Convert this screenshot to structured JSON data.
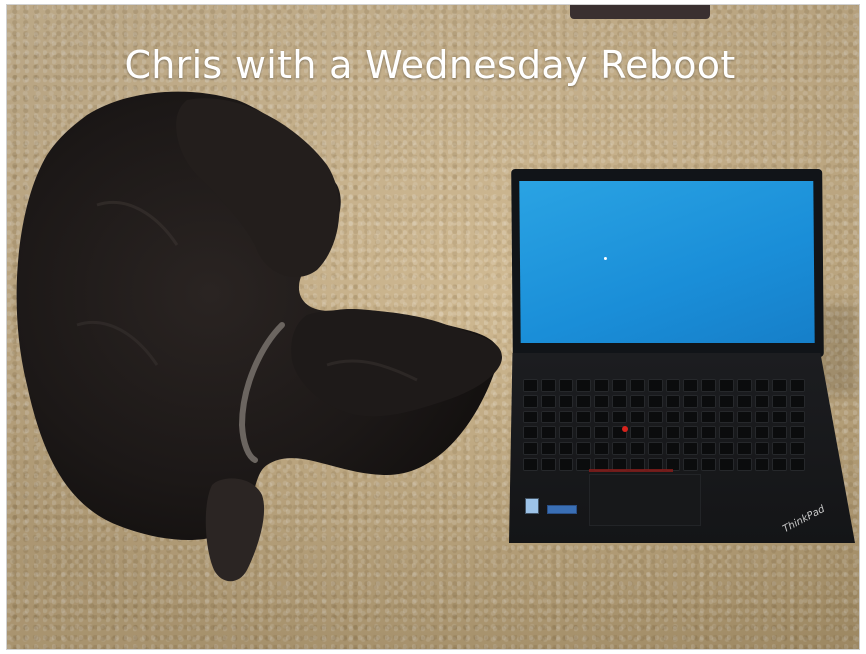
{
  "caption": "Chris with a Wednesday Reboot",
  "laptop": {
    "screen_color": "#1a8ed8",
    "brand_logo": "ThinkPad"
  },
  "colors": {
    "carpet": "#c9b188",
    "dog_fur": "#1f1b1a",
    "caption_text": "#ffffff",
    "trackpoint": "#d9231c"
  }
}
